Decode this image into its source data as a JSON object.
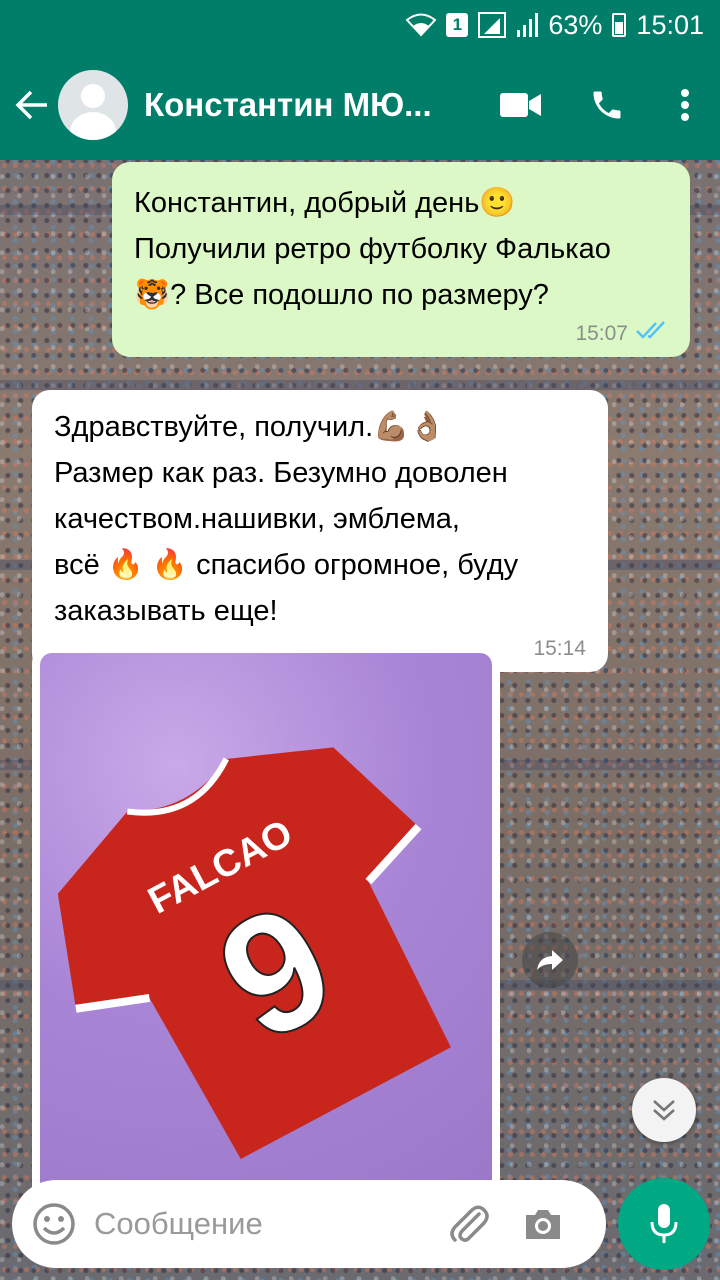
{
  "status_bar": {
    "sim": "1",
    "battery": "63%",
    "time": "15:01"
  },
  "chat_header": {
    "contact_name": "Константин МЮ..."
  },
  "messages": [
    {
      "direction": "outgoing",
      "text": "Константин, добрый день🙂\nПолучили ретро футболку Фалькао\n🐯? Все подошло по размеру?",
      "time": "15:07",
      "status": "read"
    },
    {
      "direction": "incoming",
      "text": "Здравствуйте, получил.💪🏽👌🏽\nРазмер как раз. Безумно доволен\nкачеством.нашивки, эмблема,\nвсё 🔥 🔥 спасибо огромное, буду\nзаказывать еще!",
      "time": "15:14"
    },
    {
      "direction": "incoming",
      "type": "image",
      "shirt_name": "FALCAO",
      "shirt_number": "9"
    }
  ],
  "composer": {
    "placeholder": "Сообщение"
  },
  "colors": {
    "header": "#007e6a",
    "outgoing_bubble": "#dcf8c6",
    "incoming_bubble": "#ffffff",
    "accent": "#00a884",
    "read_ticks": "#4fc3f7"
  },
  "icons": [
    "wifi-icon",
    "signal-icon",
    "battery-icon",
    "back-arrow-icon",
    "video-call-icon",
    "phone-icon",
    "more-vert-icon",
    "share-icon",
    "chevron-double-down-icon",
    "emoji-icon",
    "attach-icon",
    "camera-icon",
    "mic-icon"
  ]
}
